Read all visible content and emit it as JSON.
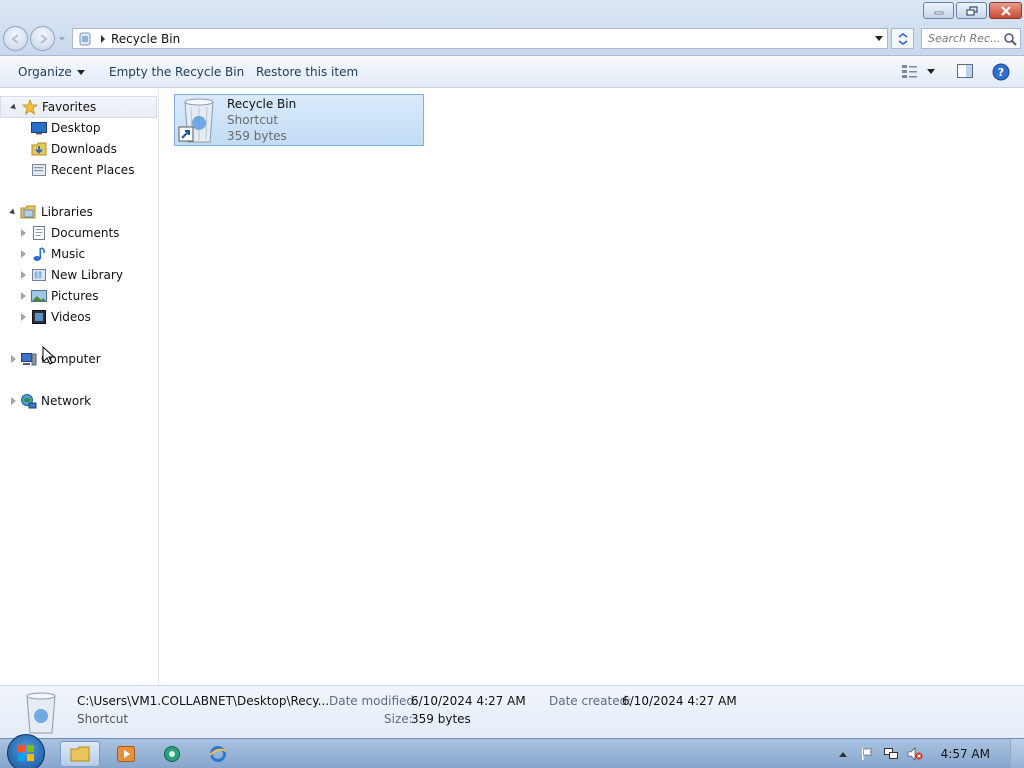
{
  "window": {
    "minimize_icon": "minimize-icon",
    "restore_icon": "restore-icon",
    "close_icon": "close-icon",
    "close_color": "#c84a33"
  },
  "address_bar": {
    "location": "Recycle Bin",
    "search_placeholder": "Search Rec..."
  },
  "toolbar": {
    "organize": "Organize",
    "empty_recycle_bin": "Empty the Recycle Bin",
    "restore_item": "Restore this item"
  },
  "nav": {
    "favorites": {
      "label": "Favorites",
      "items": [
        {
          "label": "Desktop"
        },
        {
          "label": "Downloads"
        },
        {
          "label": "Recent Places"
        }
      ]
    },
    "libraries": {
      "label": "Libraries",
      "items": [
        {
          "label": "Documents"
        },
        {
          "label": "Music"
        },
        {
          "label": "New Library"
        },
        {
          "label": "Pictures"
        },
        {
          "label": "Videos"
        }
      ]
    },
    "computer": "Computer",
    "network": "Network"
  },
  "content": {
    "items": [
      {
        "name": "Recycle Bin",
        "type": "Shortcut",
        "size": "359 bytes",
        "selected": true
      }
    ]
  },
  "details": {
    "path": "C:\\Users\\VM1.COLLABNET\\Desktop\\Recy...",
    "type": "Shortcut",
    "date_modified_label": "Date modified:",
    "date_modified": "6/10/2024 4:27 AM",
    "date_created_label": "Date created:",
    "date_created": "6/10/2024 4:27 AM",
    "size_label": "Size:",
    "size": "359 bytes"
  },
  "taskbar": {
    "clock": "4:57 AM",
    "accent": "#86a6cd"
  }
}
